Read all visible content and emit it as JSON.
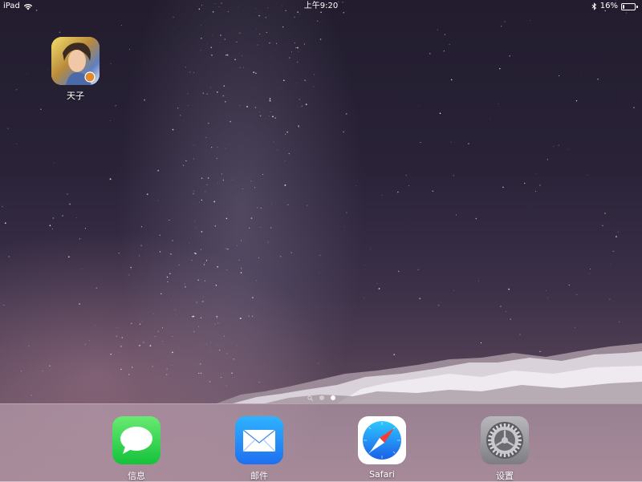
{
  "status_bar": {
    "device": "iPad",
    "time": "上午9:20",
    "battery": "16%",
    "battery_level": 0.16
  },
  "home_apps": [
    {
      "label": "天子",
      "icon": "game-app-icon"
    }
  ],
  "page_indicator": {
    "pages": 2,
    "active_index": 1
  },
  "dock": {
    "apps": [
      {
        "label": "信息",
        "icon": "messages-icon"
      },
      {
        "label": "邮件",
        "icon": "mail-icon"
      },
      {
        "label": "Safari",
        "icon": "safari-icon"
      },
      {
        "label": "设置",
        "icon": "settings-icon"
      }
    ]
  },
  "colors": {
    "messages": "#14c23a",
    "mail": "#1e6ff0",
    "safari_needle": "#ff3b30",
    "settings": "#8e8e93"
  }
}
